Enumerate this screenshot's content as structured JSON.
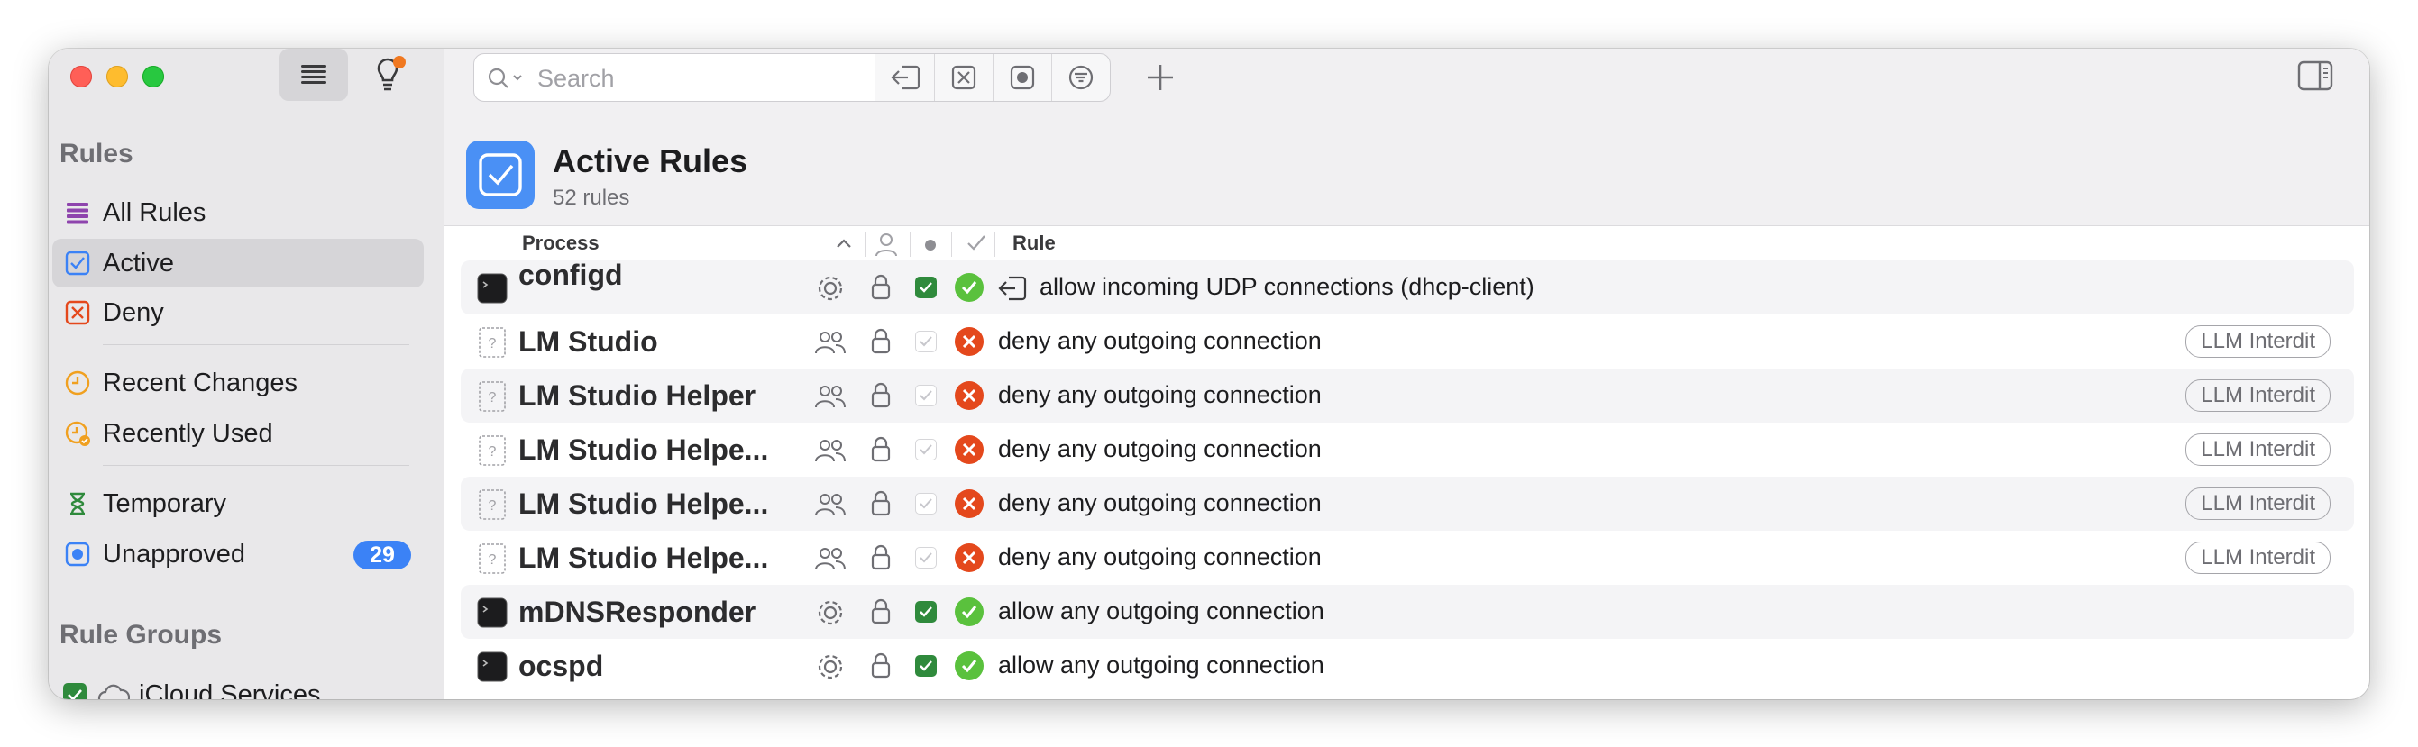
{
  "sidebar": {
    "sections": [
      {
        "title": "Rules"
      },
      {
        "title": "Rule Groups"
      }
    ],
    "items": [
      {
        "label": "All Rules",
        "icon": "list-icon",
        "color": "#8e44ad"
      },
      {
        "label": "Active",
        "icon": "checkbox-icon",
        "color": "#3b82f6",
        "selected": true
      },
      {
        "label": "Deny",
        "icon": "x-square-icon",
        "color": "#e4481c"
      },
      {
        "label": "Recent Changes",
        "icon": "clock-icon",
        "color": "#f0a020"
      },
      {
        "label": "Recently Used",
        "icon": "clock-check-icon",
        "color": "#f0a020"
      },
      {
        "label": "Temporary",
        "icon": "hourglass-icon",
        "color": "#2f8a3c"
      },
      {
        "label": "Unapproved",
        "icon": "record-icon",
        "color": "#3b82f6",
        "badge": "29"
      }
    ],
    "groups": [
      {
        "label": "iCloud Services",
        "icon": "cloud-icon",
        "checked": true
      }
    ]
  },
  "toolbar": {
    "search_placeholder": "Search",
    "buttons": [
      "incoming-icon",
      "deny-icon",
      "record-icon",
      "filter-icon"
    ],
    "add_icon": "plus-icon",
    "panel_icon": "sidebar-right-icon"
  },
  "header": {
    "title": "Active Rules",
    "subtitle": "52 rules"
  },
  "columns": {
    "process": "Process",
    "rule": "Rule"
  },
  "rows": [
    {
      "name": "configd",
      "icon": "terminal",
      "user": "gear",
      "checked": true,
      "status": "allow",
      "direction": "incoming",
      "rule": "allow incoming UDP connections (dhcp-client)",
      "tag": ""
    },
    {
      "name": "LM Studio",
      "icon": "unknown",
      "user": "users",
      "checked": false,
      "status": "deny",
      "direction": "",
      "rule": "deny any outgoing connection",
      "tag": "LLM Interdit"
    },
    {
      "name": "LM Studio Helper",
      "icon": "unknown",
      "user": "users",
      "checked": false,
      "status": "deny",
      "direction": "",
      "rule": "deny any outgoing connection",
      "tag": "LLM Interdit"
    },
    {
      "name": "LM Studio Helpe...",
      "icon": "unknown",
      "user": "users",
      "checked": false,
      "status": "deny",
      "direction": "",
      "rule": "deny any outgoing connection",
      "tag": "LLM Interdit"
    },
    {
      "name": "LM Studio Helpe...",
      "icon": "unknown",
      "user": "users",
      "checked": false,
      "status": "deny",
      "direction": "",
      "rule": "deny any outgoing connection",
      "tag": "LLM Interdit"
    },
    {
      "name": "LM Studio Helpe...",
      "icon": "unknown",
      "user": "users",
      "checked": false,
      "status": "deny",
      "direction": "",
      "rule": "deny any outgoing connection",
      "tag": "LLM Interdit"
    },
    {
      "name": "mDNSResponder",
      "icon": "terminal",
      "user": "gear",
      "checked": true,
      "status": "allow",
      "direction": "",
      "rule": "allow any outgoing connection",
      "tag": ""
    },
    {
      "name": "ocspd",
      "icon": "terminal",
      "user": "gear",
      "checked": true,
      "status": "allow",
      "direction": "",
      "rule": "allow any outgoing connection",
      "tag": ""
    }
  ]
}
